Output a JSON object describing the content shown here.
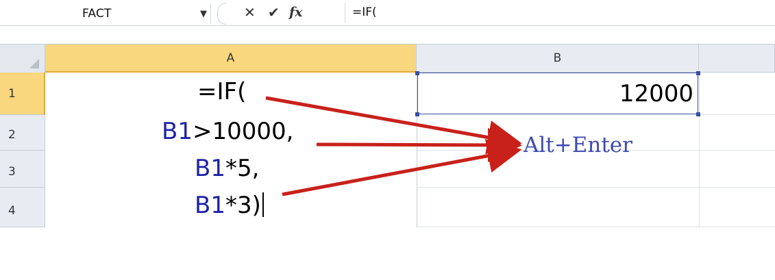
{
  "formula_bar": {
    "name_box": "FACT",
    "formula": "=IF("
  },
  "columns": [
    "A",
    "B"
  ],
  "rows": [
    "1",
    "2",
    "3",
    "4"
  ],
  "cell_a1_formula_lines": [
    {
      "ref": "",
      "text": "=IF("
    },
    {
      "ref": "B1",
      "text": ">10000,"
    },
    {
      "ref": "B1",
      "text": "*5,"
    },
    {
      "ref": "B1",
      "text": "*3)"
    }
  ],
  "cell_b1_value": "12000",
  "annotation": "Alt+Enter",
  "colors": {
    "arrow": "#c8211b",
    "cell_reference": "#1f22a8",
    "active_header": "#f9d77e",
    "selection_border": "#3a4ea3"
  }
}
